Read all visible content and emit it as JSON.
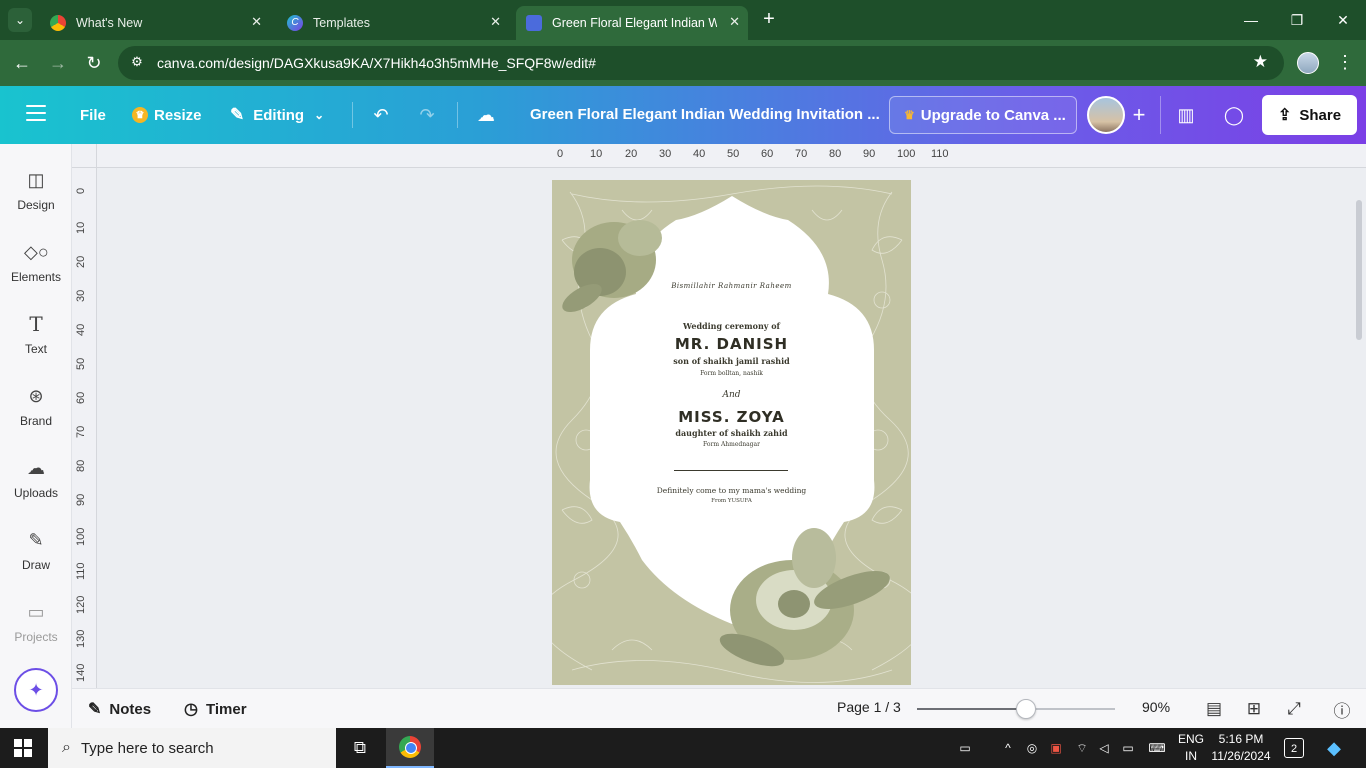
{
  "browser": {
    "tabs": [
      {
        "title": "What's New",
        "icon": "chrome-icon"
      },
      {
        "title": "Templates",
        "icon": "canva-icon"
      },
      {
        "title": "Green Floral Elegant Indian Wedding Invitation",
        "icon": "canva-doc-icon",
        "active": true
      }
    ],
    "url": "canva.com/design/DAGXkusa9KA/X7Hikh4o3h5mMHe_SFQF8w/edit#"
  },
  "header": {
    "file_label": "File",
    "resize_label": "Resize",
    "mode_label": "Editing",
    "title": "Green Floral Elegant Indian Wedding Invitation ...",
    "upgrade_label": "Upgrade to Canva ...",
    "share_label": "Share"
  },
  "sidebar": {
    "items": [
      {
        "label": "Design",
        "icon": "design-icon"
      },
      {
        "label": "Elements",
        "icon": "elements-icon"
      },
      {
        "label": "Text",
        "icon": "text-icon"
      },
      {
        "label": "Brand",
        "icon": "brand-icon"
      },
      {
        "label": "Uploads",
        "icon": "uploads-icon"
      },
      {
        "label": "Draw",
        "icon": "draw-icon"
      },
      {
        "label": "Projects",
        "icon": "projects-icon"
      }
    ]
  },
  "ruler": {
    "h_ticks": [
      "0",
      "10",
      "20",
      "30",
      "40",
      "50",
      "60",
      "70",
      "80",
      "90",
      "100",
      "110"
    ],
    "v_ticks": [
      "0",
      "10",
      "20",
      "30",
      "40",
      "50",
      "60",
      "70",
      "80",
      "90",
      "100",
      "110",
      "120",
      "130",
      "140"
    ]
  },
  "invitation": {
    "bismillah": "Bismillahir Rahmanir Raheem",
    "ceremony": "Wedding ceremony of",
    "groom": "MR. DANISH",
    "groom_parent": "son of shaikh jamil rashid",
    "groom_from": "Form bolltan, nashik",
    "and": "And",
    "bride": "MISS. ZOYA",
    "bride_parent": "daughter of shaikh zahid",
    "bride_from": "Form Ahmednagar",
    "invite_note": "Definitely come to my mama's wedding",
    "invite_from": "From YUSUFA",
    "colors": {
      "background": "#c3c4a4",
      "card": "#ffffff",
      "text": "#3b3a2e"
    }
  },
  "bottombar": {
    "notes_label": "Notes",
    "timer_label": "Timer",
    "page_label": "Page 1 / 3",
    "zoom_label": "90%",
    "zoom_fraction": 0.55
  },
  "taskbar": {
    "search_placeholder": "Type here to search",
    "lang_line1": "ENG",
    "lang_line2": "IN",
    "time": "5:16 PM",
    "date": "11/26/2024",
    "notification_count": "2"
  }
}
